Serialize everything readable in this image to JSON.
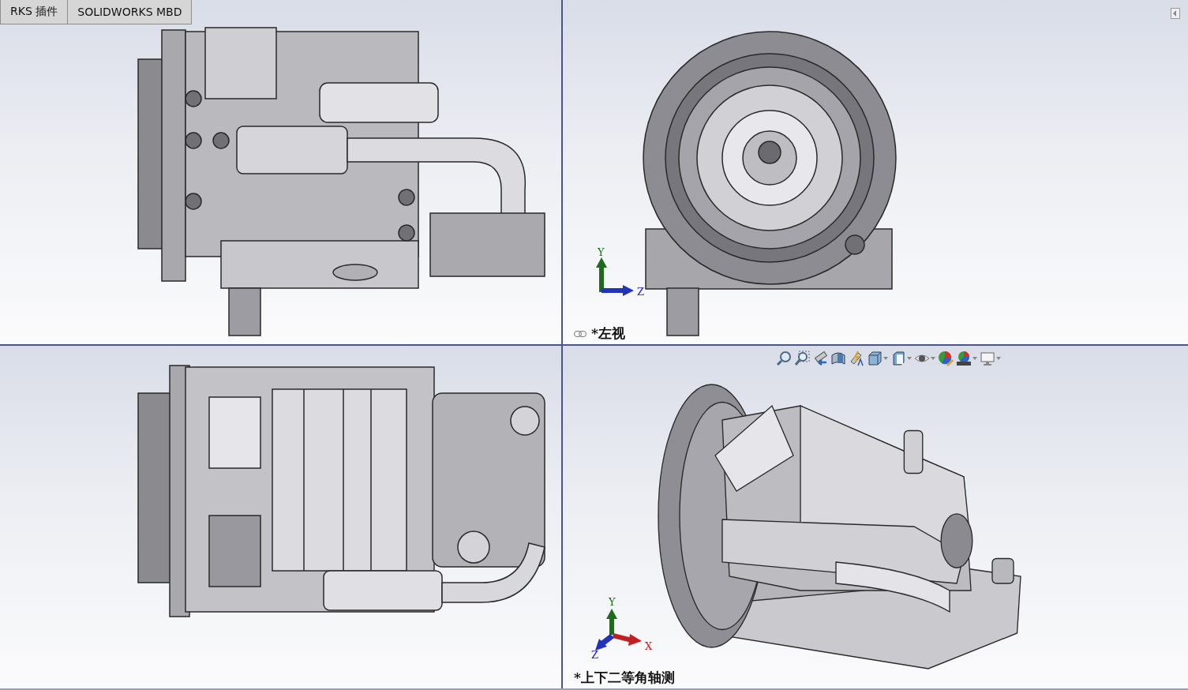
{
  "tabs": [
    {
      "label": "RKS 插件",
      "selected": false
    },
    {
      "label": "SOLIDWORKS MBD",
      "selected": false
    }
  ],
  "viewports": [
    {
      "kind": "side"
    },
    {
      "kind": "front",
      "linked": true,
      "label": "*左视",
      "triad": {
        "kind": "yz",
        "labels": [
          "Y",
          "Z"
        ]
      }
    },
    {
      "kind": "top"
    },
    {
      "kind": "isometric",
      "label": "*上下二等角轴测",
      "triad": {
        "kind": "iso",
        "labels": [
          "Y",
          "X",
          "Z"
        ]
      },
      "toolbar": [
        {
          "kind": "zoom-fit",
          "dropdown": false
        },
        {
          "kind": "zoom-area",
          "dropdown": false
        },
        {
          "kind": "previous-view",
          "dropdown": false
        },
        {
          "kind": "section",
          "dropdown": false
        },
        {
          "kind": "annotation",
          "dropdown": false
        },
        {
          "kind": "orientation",
          "dropdown": true
        },
        {
          "kind": "display-style",
          "dropdown": true
        },
        {
          "kind": "hide-show",
          "dropdown": true
        },
        {
          "kind": "appearance",
          "dropdown": false
        },
        {
          "kind": "scene",
          "dropdown": true
        },
        {
          "kind": "settings",
          "dropdown": true
        }
      ]
    }
  ]
}
